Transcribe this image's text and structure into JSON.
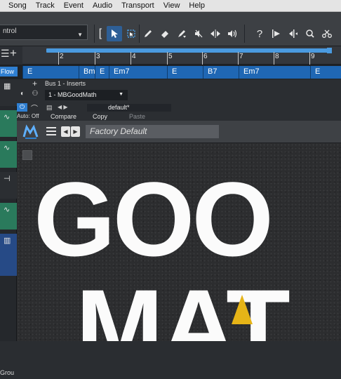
{
  "menubar": {
    "items": [
      "Song",
      "Track",
      "Event",
      "Audio",
      "Transport",
      "View",
      "Help"
    ]
  },
  "toolbar": {
    "control_field": "ntrol",
    "tools": [
      "[",
      "arrow-select-icon",
      "range-select-icon",
      "pencil-icon",
      "eraser-icon",
      "paint-icon",
      "mute-icon",
      "split-icon",
      "speaker-icon",
      "help-icon",
      "snap-icon",
      "bend-icon",
      "search-icon",
      "scissors-icon"
    ]
  },
  "ruler": {
    "bars": [
      "2",
      "3",
      "4",
      "5",
      "6",
      "7",
      "8",
      "9"
    ]
  },
  "chord_track": {
    "label": "Flow",
    "chords": [
      "E",
      "Bm",
      "E",
      "Em7",
      "E",
      "B7",
      "Em7",
      "E"
    ]
  },
  "inserts": {
    "header": "Bus 1 - Inserts",
    "plugin_name": "1 - MBGoodMath",
    "preset": "default*",
    "auto": "Auto: Off",
    "compare": "Compare",
    "copy": "Copy",
    "paste": "Paste"
  },
  "plugin": {
    "preset_display": "Factory Default",
    "big_text_line1": "GOO",
    "big_text_line2": "MAT",
    "accent_color": "#e6b417"
  },
  "left_panel": {
    "group_label": "Grou"
  }
}
